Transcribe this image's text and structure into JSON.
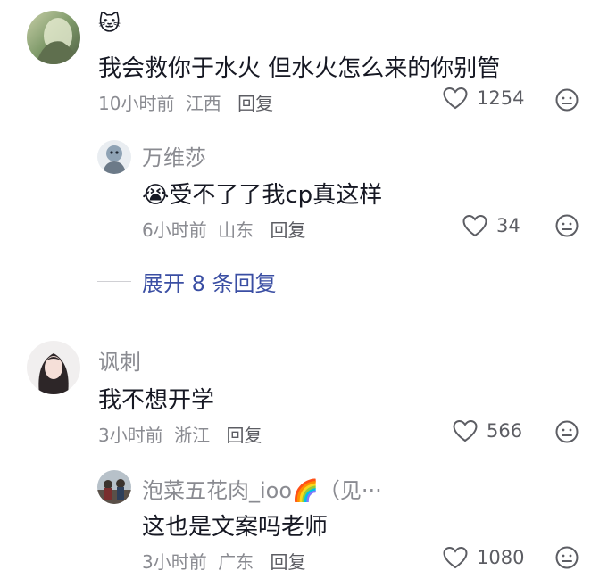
{
  "comments": [
    {
      "user_name": "",
      "name_emoji": "🐱",
      "text": "我会救你于水火 但水火怎么来的你别管",
      "time": "10小时前",
      "location": "江西",
      "reply_label": "回复",
      "likes": "1254",
      "replies": [
        {
          "user_name": "万维莎",
          "emoji": "😭",
          "text": "受不了了我cp真这样",
          "time": "6小时前",
          "location": "山东",
          "reply_label": "回复",
          "likes": "34"
        }
      ],
      "expand_label": "展开 8 条回复"
    },
    {
      "user_name": "讽刺",
      "text": "我不想开学",
      "time": "3小时前",
      "location": "浙江",
      "reply_label": "回复",
      "likes": "566",
      "replies": [
        {
          "user_name": "泡菜五花肉_ioo🌈（见···",
          "text": "这也是文案吗老师",
          "time": "3小时前",
          "location": "广东",
          "reply_label": "回复",
          "likes": "1080"
        }
      ]
    }
  ],
  "icons": {
    "like": "heart-outline-icon",
    "dislike": "frown-face-icon"
  },
  "colors": {
    "name": "#8a8b91",
    "text": "#161823",
    "expand": "#3a4ea3"
  }
}
